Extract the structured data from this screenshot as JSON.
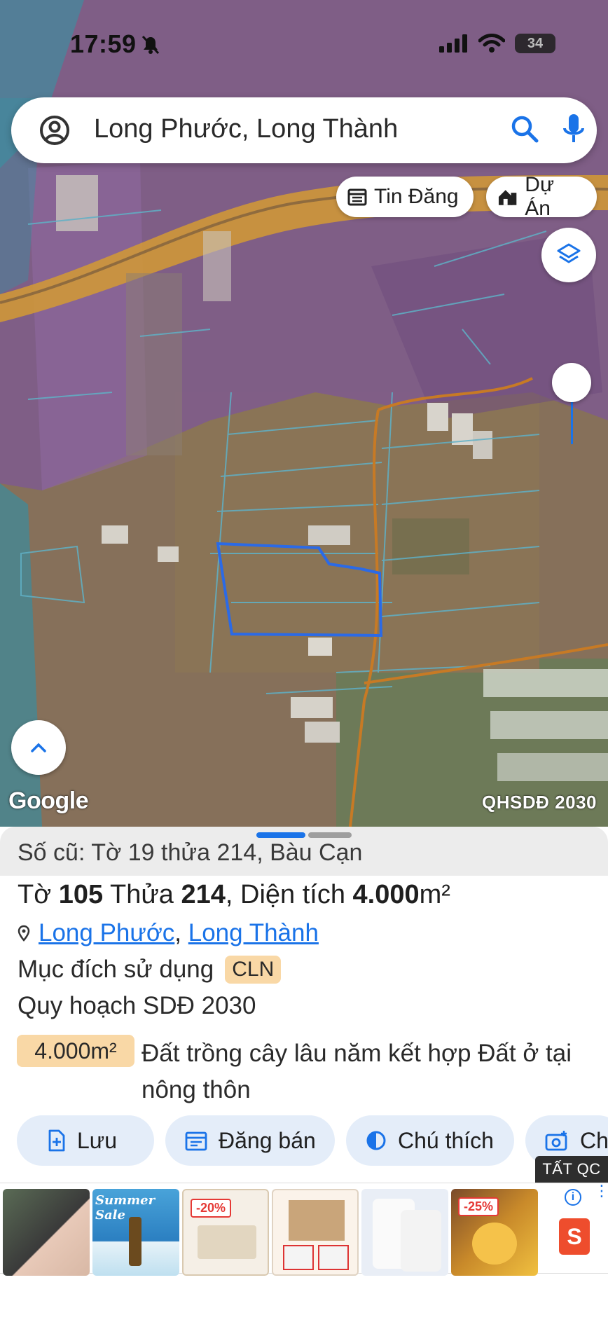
{
  "status": {
    "time": "17:59",
    "battery": "34"
  },
  "search": {
    "query": "Long Phước, Long Thành"
  },
  "chips": {
    "posts": "Tin Đăng",
    "projects": "Dự Án"
  },
  "map": {
    "google_logo": "Google",
    "overlay_label": "QHSDĐ 2030"
  },
  "parcel": {
    "old_ref": "Số cũ: Tờ 19 thửa 214, Bàu Cạn",
    "sheet_label": "Tờ",
    "sheet_no": "105",
    "plot_label": "Thửa",
    "plot_no": "214",
    "area_label": "Diện tích",
    "area": "4.000",
    "area_unit": "m²",
    "ward": "Long Phước",
    "separator": ",",
    "district": "Long Thành",
    "purpose_label": "Mục đích sử dụng",
    "purpose_code": "CLN",
    "plan_title": "Quy hoạch SDĐ 2030",
    "plan_area": "4.000m²",
    "plan_desc": "Đất trồng cây lâu năm kết hợp Đất ở tại nông thôn"
  },
  "actions": {
    "save": "Lưu",
    "sell": "Đăng bán",
    "legend": "Chú thích",
    "photo": "Ch"
  },
  "ads": {
    "label": "TẤT QC",
    "tile2_caption": "Summer Sale",
    "tile3_tag": "-20%",
    "tile6_tag": "-25%",
    "info": "i",
    "shop": "S"
  },
  "colors": {
    "accent": "#1a73e8",
    "zone_purple": "#8a5a9e",
    "zone_orange": "#d9972c",
    "zone_teal": "#3aa6b9",
    "parcel_outline": "#2b6ae6",
    "badge": "#f9d8a6"
  }
}
